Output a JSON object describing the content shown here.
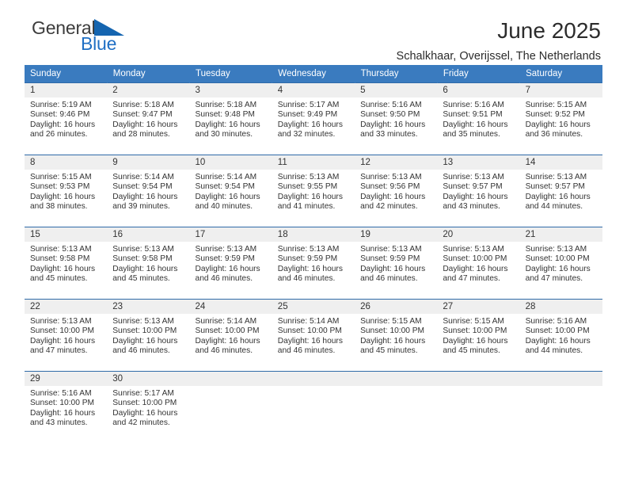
{
  "brand": {
    "name_part1": "General",
    "name_part2": "Blue",
    "triangle_icon": "blue-triangle-icon",
    "color_text": "#3c3c3c",
    "color_blue": "#1f6fc4"
  },
  "header": {
    "title": "June 2025",
    "subtitle": "Schalkhaar, Overijssel, The Netherlands"
  },
  "theme": {
    "header_bg": "#3a7bbf",
    "row_border": "#2f6aa8",
    "daynum_bg": "#efefef",
    "text": "#333333"
  },
  "weekdays": [
    "Sunday",
    "Monday",
    "Tuesday",
    "Wednesday",
    "Thursday",
    "Friday",
    "Saturday"
  ],
  "weeks": [
    [
      {
        "day": "1",
        "sunrise": "Sunrise: 5:19 AM",
        "sunset": "Sunset: 9:46 PM",
        "daylight": "Daylight: 16 hours and 26 minutes."
      },
      {
        "day": "2",
        "sunrise": "Sunrise: 5:18 AM",
        "sunset": "Sunset: 9:47 PM",
        "daylight": "Daylight: 16 hours and 28 minutes."
      },
      {
        "day": "3",
        "sunrise": "Sunrise: 5:18 AM",
        "sunset": "Sunset: 9:48 PM",
        "daylight": "Daylight: 16 hours and 30 minutes."
      },
      {
        "day": "4",
        "sunrise": "Sunrise: 5:17 AM",
        "sunset": "Sunset: 9:49 PM",
        "daylight": "Daylight: 16 hours and 32 minutes."
      },
      {
        "day": "5",
        "sunrise": "Sunrise: 5:16 AM",
        "sunset": "Sunset: 9:50 PM",
        "daylight": "Daylight: 16 hours and 33 minutes."
      },
      {
        "day": "6",
        "sunrise": "Sunrise: 5:16 AM",
        "sunset": "Sunset: 9:51 PM",
        "daylight": "Daylight: 16 hours and 35 minutes."
      },
      {
        "day": "7",
        "sunrise": "Sunrise: 5:15 AM",
        "sunset": "Sunset: 9:52 PM",
        "daylight": "Daylight: 16 hours and 36 minutes."
      }
    ],
    [
      {
        "day": "8",
        "sunrise": "Sunrise: 5:15 AM",
        "sunset": "Sunset: 9:53 PM",
        "daylight": "Daylight: 16 hours and 38 minutes."
      },
      {
        "day": "9",
        "sunrise": "Sunrise: 5:14 AM",
        "sunset": "Sunset: 9:54 PM",
        "daylight": "Daylight: 16 hours and 39 minutes."
      },
      {
        "day": "10",
        "sunrise": "Sunrise: 5:14 AM",
        "sunset": "Sunset: 9:54 PM",
        "daylight": "Daylight: 16 hours and 40 minutes."
      },
      {
        "day": "11",
        "sunrise": "Sunrise: 5:13 AM",
        "sunset": "Sunset: 9:55 PM",
        "daylight": "Daylight: 16 hours and 41 minutes."
      },
      {
        "day": "12",
        "sunrise": "Sunrise: 5:13 AM",
        "sunset": "Sunset: 9:56 PM",
        "daylight": "Daylight: 16 hours and 42 minutes."
      },
      {
        "day": "13",
        "sunrise": "Sunrise: 5:13 AM",
        "sunset": "Sunset: 9:57 PM",
        "daylight": "Daylight: 16 hours and 43 minutes."
      },
      {
        "day": "14",
        "sunrise": "Sunrise: 5:13 AM",
        "sunset": "Sunset: 9:57 PM",
        "daylight": "Daylight: 16 hours and 44 minutes."
      }
    ],
    [
      {
        "day": "15",
        "sunrise": "Sunrise: 5:13 AM",
        "sunset": "Sunset: 9:58 PM",
        "daylight": "Daylight: 16 hours and 45 minutes."
      },
      {
        "day": "16",
        "sunrise": "Sunrise: 5:13 AM",
        "sunset": "Sunset: 9:58 PM",
        "daylight": "Daylight: 16 hours and 45 minutes."
      },
      {
        "day": "17",
        "sunrise": "Sunrise: 5:13 AM",
        "sunset": "Sunset: 9:59 PM",
        "daylight": "Daylight: 16 hours and 46 minutes."
      },
      {
        "day": "18",
        "sunrise": "Sunrise: 5:13 AM",
        "sunset": "Sunset: 9:59 PM",
        "daylight": "Daylight: 16 hours and 46 minutes."
      },
      {
        "day": "19",
        "sunrise": "Sunrise: 5:13 AM",
        "sunset": "Sunset: 9:59 PM",
        "daylight": "Daylight: 16 hours and 46 minutes."
      },
      {
        "day": "20",
        "sunrise": "Sunrise: 5:13 AM",
        "sunset": "Sunset: 10:00 PM",
        "daylight": "Daylight: 16 hours and 47 minutes."
      },
      {
        "day": "21",
        "sunrise": "Sunrise: 5:13 AM",
        "sunset": "Sunset: 10:00 PM",
        "daylight": "Daylight: 16 hours and 47 minutes."
      }
    ],
    [
      {
        "day": "22",
        "sunrise": "Sunrise: 5:13 AM",
        "sunset": "Sunset: 10:00 PM",
        "daylight": "Daylight: 16 hours and 47 minutes."
      },
      {
        "day": "23",
        "sunrise": "Sunrise: 5:13 AM",
        "sunset": "Sunset: 10:00 PM",
        "daylight": "Daylight: 16 hours and 46 minutes."
      },
      {
        "day": "24",
        "sunrise": "Sunrise: 5:14 AM",
        "sunset": "Sunset: 10:00 PM",
        "daylight": "Daylight: 16 hours and 46 minutes."
      },
      {
        "day": "25",
        "sunrise": "Sunrise: 5:14 AM",
        "sunset": "Sunset: 10:00 PM",
        "daylight": "Daylight: 16 hours and 46 minutes."
      },
      {
        "day": "26",
        "sunrise": "Sunrise: 5:15 AM",
        "sunset": "Sunset: 10:00 PM",
        "daylight": "Daylight: 16 hours and 45 minutes."
      },
      {
        "day": "27",
        "sunrise": "Sunrise: 5:15 AM",
        "sunset": "Sunset: 10:00 PM",
        "daylight": "Daylight: 16 hours and 45 minutes."
      },
      {
        "day": "28",
        "sunrise": "Sunrise: 5:16 AM",
        "sunset": "Sunset: 10:00 PM",
        "daylight": "Daylight: 16 hours and 44 minutes."
      }
    ],
    [
      {
        "day": "29",
        "sunrise": "Sunrise: 5:16 AM",
        "sunset": "Sunset: 10:00 PM",
        "daylight": "Daylight: 16 hours and 43 minutes."
      },
      {
        "day": "30",
        "sunrise": "Sunrise: 5:17 AM",
        "sunset": "Sunset: 10:00 PM",
        "daylight": "Daylight: 16 hours and 42 minutes."
      },
      {
        "day": "",
        "sunrise": "",
        "sunset": "",
        "daylight": ""
      },
      {
        "day": "",
        "sunrise": "",
        "sunset": "",
        "daylight": ""
      },
      {
        "day": "",
        "sunrise": "",
        "sunset": "",
        "daylight": ""
      },
      {
        "day": "",
        "sunrise": "",
        "sunset": "",
        "daylight": ""
      },
      {
        "day": "",
        "sunrise": "",
        "sunset": "",
        "daylight": ""
      }
    ]
  ]
}
